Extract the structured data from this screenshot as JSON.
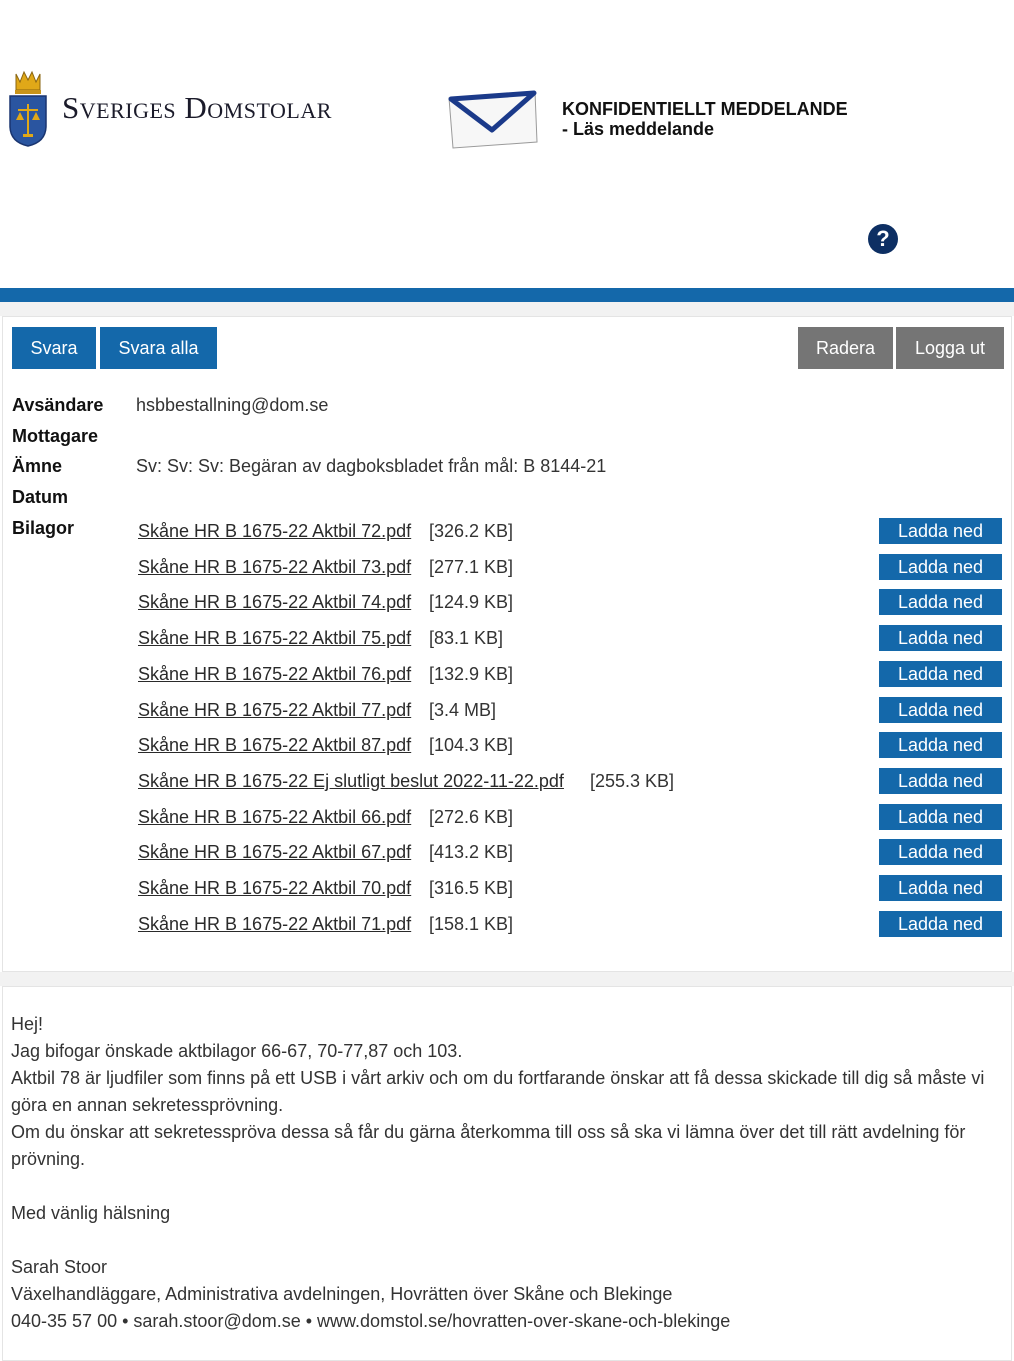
{
  "header": {
    "logo_text": "Sveriges Domstolar",
    "title_line1": "KONFIDENTIELLT MEDDELANDE",
    "title_line2": "- Läs meddelande",
    "help_symbol": "?"
  },
  "colors": {
    "primary": "#1468aa",
    "secondary_button": "#757575",
    "help_icon": "#0d2f63"
  },
  "toolbar": {
    "reply_label": "Svara",
    "reply_all_label": "Svara alla",
    "delete_label": "Radera",
    "logout_label": "Logga ut"
  },
  "meta": {
    "sender_label": "Avsändare",
    "sender_value": "hsbbestallning@dom.se",
    "recipient_label": "Mottagare",
    "recipient_value": "",
    "subject_label": "Ämne",
    "subject_value": "Sv: Sv: Sv: Begäran av dagboksbladet från mål: B 8144-21",
    "date_label": "Datum",
    "date_value": "",
    "attachments_label": "Bilagor"
  },
  "download_label": "Ladda ned",
  "attachments": [
    {
      "name": "Skåne HR B 1675-22 Aktbil 72.pdf",
      "size": "[326.2 KB]"
    },
    {
      "name": "Skåne HR B 1675-22 Aktbil 73.pdf",
      "size": "[277.1 KB]"
    },
    {
      "name": "Skåne HR B 1675-22 Aktbil 74.pdf",
      "size": "[124.9 KB]"
    },
    {
      "name": "Skåne HR B 1675-22 Aktbil 75.pdf",
      "size": "[83.1 KB]"
    },
    {
      "name": "Skåne HR B 1675-22 Aktbil 76.pdf",
      "size": "[132.9 KB]"
    },
    {
      "name": "Skåne HR B 1675-22 Aktbil 77.pdf",
      "size": "[3.4 MB]"
    },
    {
      "name": "Skåne HR B 1675-22 Aktbil 87.pdf",
      "size": "[104.3 KB]"
    },
    {
      "name": "Skåne HR B 1675-22 Ej slutligt beslut 2022-11-22.pdf",
      "size": "[255.3 KB]"
    },
    {
      "name": "Skåne HR B 1675-22 Aktbil 66.pdf",
      "size": "[272.6 KB]"
    },
    {
      "name": "Skåne HR B 1675-22 Aktbil 67.pdf",
      "size": "[413.2 KB]"
    },
    {
      "name": "Skåne HR B 1675-22 Aktbil 70.pdf",
      "size": "[316.5 KB]"
    },
    {
      "name": "Skåne HR B 1675-22 Aktbil 71.pdf",
      "size": "[158.1 KB]"
    }
  ],
  "message": {
    "greeting": "Hej!",
    "line1": "Jag bifogar önskade aktbilagor 66-67, 70-77,87 och 103.",
    "line2": "Aktbil 78 är ljudfiler som finns på ett USB i vårt arkiv och om du fortfarande önskar att få dessa skickade till dig så måste vi göra en annan sekretessprövning.",
    "line3": "Om du önskar att sekretesspröva dessa så får du gärna återkomma till oss så ska vi lämna över det till rätt avdelning för prövning.",
    "closing": "Med vänlig hälsning",
    "signature_name": "Sarah Stoor",
    "signature_title": "Växelhandläggare, Administrativa avdelningen, Hovrätten över Skåne och Blekinge",
    "signature_contact": "040-35 57 00 • sarah.stoor@dom.se • www.domstol.se/hovratten-over-skane-och-blekinge"
  }
}
